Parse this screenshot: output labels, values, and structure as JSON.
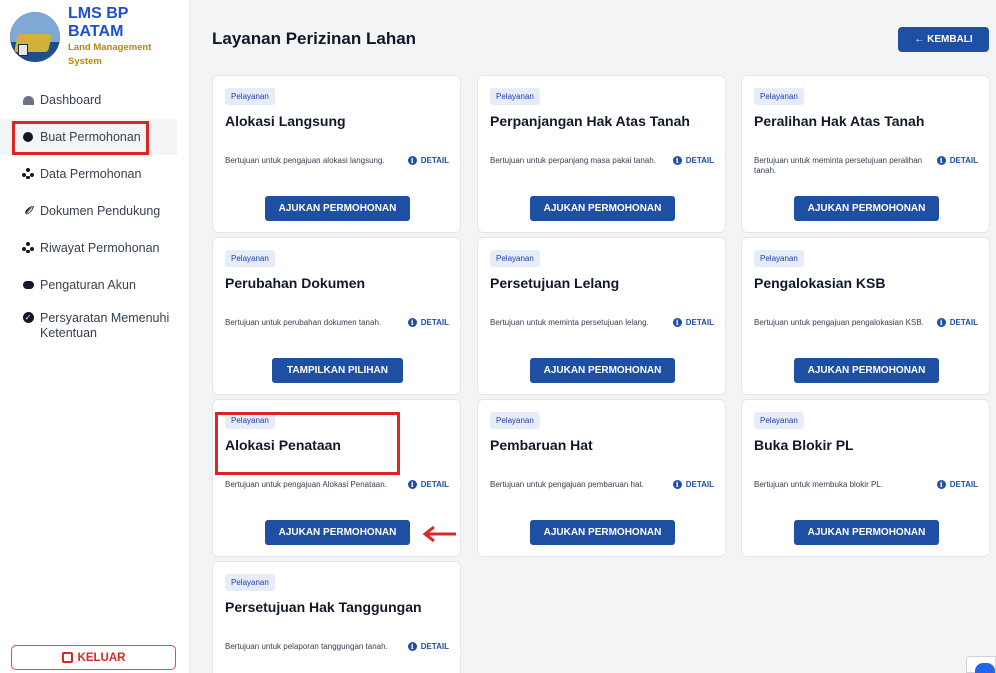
{
  "brand": {
    "title": "LMS BP BATAM",
    "subtitle": "Land Management System"
  },
  "sidebar": {
    "items": [
      {
        "label": "Dashboard",
        "icon": "dashboard-icon"
      },
      {
        "label": "Buat Permohonan",
        "icon": "file-icon",
        "active": true
      },
      {
        "label": "Data Permohonan",
        "icon": "users-icon"
      },
      {
        "label": "Dokumen Pendukung",
        "icon": "paperclip-icon"
      },
      {
        "label": "Riwayat Permohonan",
        "icon": "users-icon"
      },
      {
        "label": "Pengaturan Akun",
        "icon": "toggle-icon"
      },
      {
        "label": "Persyaratan Memenuhi Ketentuan",
        "icon": "check-circle-icon"
      }
    ],
    "logout_label": "KELUAR"
  },
  "header": {
    "title": "Layanan Perizinan Lahan",
    "back_label": "← KEMBALI"
  },
  "colors": {
    "primary": "#1e4fa3",
    "badge_bg": "#e6edf8",
    "annotation": "#dc2626",
    "brand_title": "#1d4ed8",
    "brand_sub": "#b8860b"
  },
  "cards": [
    {
      "badge": "Pelayanan",
      "title": "Alokasi Langsung",
      "desc": "Bertujuan untuk pengajuan alokasi langsung.",
      "detail": "DETAIL",
      "button": "AJUKAN PERMOHONAN"
    },
    {
      "badge": "Pelayanan",
      "title": "Perpanjangan Hak Atas Tanah",
      "desc": "Bertujuan untuk perpanjang masa pakai tanah.",
      "detail": "DETAIL",
      "button": "AJUKAN PERMOHONAN"
    },
    {
      "badge": "Pelayanan",
      "title": "Peralihan Hak Atas Tanah",
      "desc": "Bertujuan untuk meminta persetujuan peralihan tanah.",
      "detail": "DETAIL",
      "button": "AJUKAN PERMOHONAN"
    },
    {
      "badge": "Pelayanan",
      "title": "Perubahan Dokumen",
      "desc": "Bertujuan untuk perubahan dokumen tanah.",
      "detail": "DETAIL",
      "button": "TAMPILKAN PILIHAN"
    },
    {
      "badge": "Pelayanan",
      "title": "Persetujuan Lelang",
      "desc": "Bertujuan untuk meminta persetujuan lelang.",
      "detail": "DETAIL",
      "button": "AJUKAN PERMOHONAN"
    },
    {
      "badge": "Pelayanan",
      "title": "Pengalokasian KSB",
      "desc": "Bertujuan untuk pengajuan pengalokasian KSB.",
      "detail": "DETAIL",
      "button": "AJUKAN PERMOHONAN"
    },
    {
      "badge": "Pelayanan",
      "title": "Alokasi Penataan",
      "desc": "Bertujuan untuk pengajuan Alokasi Penataan.",
      "detail": "DETAIL",
      "button": "AJUKAN PERMOHONAN"
    },
    {
      "badge": "Pelayanan",
      "title": "Pembaruan Hat",
      "desc": "Bertujuan untuk pengajuan pembaruan hat.",
      "detail": "DETAIL",
      "button": "AJUKAN PERMOHONAN"
    },
    {
      "badge": "Pelayanan",
      "title": "Buka Blokir PL",
      "desc": "Bertujuan untuk membuka blokir PL.",
      "detail": "DETAIL",
      "button": "AJUKAN PERMOHONAN"
    },
    {
      "badge": "Pelayanan",
      "title": "Persetujuan Hak Tanggungan",
      "desc": "Bertujuan untuk pelaporan tanggungan tanah.",
      "detail": "DETAIL",
      "button": ""
    }
  ]
}
